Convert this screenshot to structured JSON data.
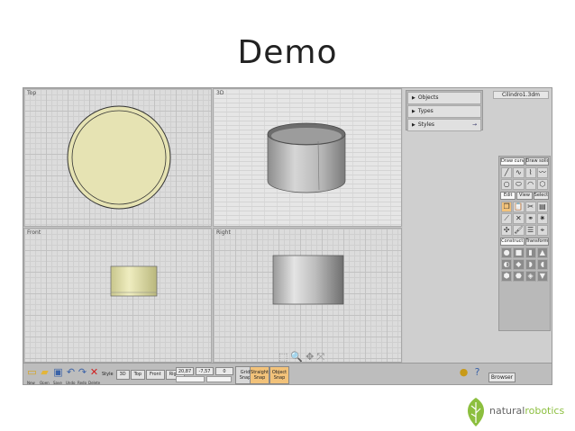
{
  "slide": {
    "title": "Demo"
  },
  "viewports": {
    "top": "Top",
    "perspective": "3D",
    "front": "Front",
    "right": "Right"
  },
  "browser": {
    "file_name": "Cilindro1.3dm",
    "rows": [
      {
        "label": "Objects",
        "end": ""
      },
      {
        "label": "Types",
        "end": ""
      },
      {
        "label": "Styles",
        "end": "→"
      }
    ]
  },
  "palette": {
    "draw_tabs": [
      "Draw curve",
      "Draw solid"
    ],
    "edit_tabs": [
      "Edit",
      "View",
      "Select"
    ],
    "construct_tabs": [
      "Construct",
      "Transform"
    ]
  },
  "toolbar": {
    "file_captions": [
      "New",
      "Open",
      "Save",
      "Undo",
      "Redo",
      "Delete"
    ],
    "style_label": "Style",
    "style_buttons": [
      "3D",
      "Top",
      "Front",
      "Right"
    ],
    "coords": [
      "20,87",
      "-7,57",
      "0"
    ],
    "snaps": [
      {
        "line1": "Grid",
        "line2": "Snap",
        "on": false
      },
      {
        "line1": "Straight",
        "line2": "Snap",
        "on": true
      },
      {
        "line1": "Object",
        "line2": "Snap",
        "on": true
      }
    ],
    "browser_button": "Browser"
  },
  "logo": {
    "part1": "natural",
    "part2": "robotics"
  },
  "colors": {
    "circle_fill": "#e6e3b3",
    "object_fill": "#e2e2b0",
    "accent_orange": "#f2c27a",
    "logo_green": "#8cbf3f"
  }
}
